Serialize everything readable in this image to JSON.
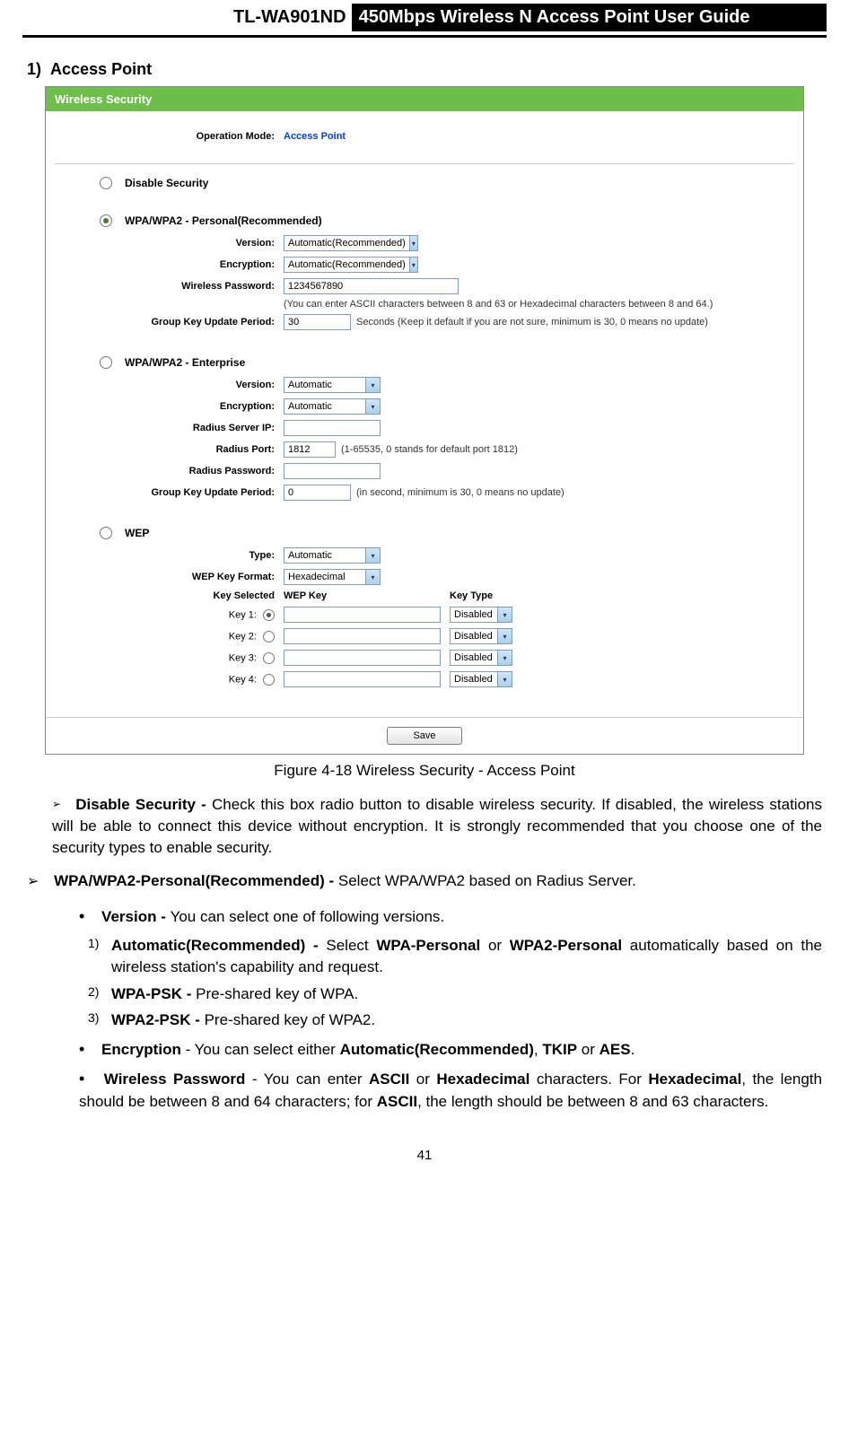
{
  "header": {
    "model": "TL-WA901ND",
    "title": "450Mbps Wireless N Access Point User Guide"
  },
  "section": {
    "number": "1)",
    "title": "Access Point"
  },
  "screenshot": {
    "bannerTitle": "Wireless Security",
    "opModeLabel": "Operation Mode:",
    "opModeValue": "Access Point",
    "disableSecurity": "Disable Security",
    "wpaPersonal": {
      "title": "WPA/WPA2 - Personal(Recommended)",
      "versionLabel": "Version:",
      "versionValue": "Automatic(Recommended)",
      "encryptionLabel": "Encryption:",
      "encryptionValue": "Automatic(Recommended)",
      "passwordLabel": "Wireless Password:",
      "passwordValue": "1234567890",
      "passwordHint": "(You can enter ASCII characters between 8 and 63 or Hexadecimal characters between 8 and 64.)",
      "groupKeyLabel": "Group Key Update Period:",
      "groupKeyValue": "30",
      "groupKeyHint": "Seconds (Keep it default if you are not sure, minimum is 30, 0 means no update)"
    },
    "wpaEnterprise": {
      "title": "WPA/WPA2 - Enterprise",
      "versionLabel": "Version:",
      "versionValue": "Automatic",
      "encryptionLabel": "Encryption:",
      "encryptionValue": "Automatic",
      "radiusIpLabel": "Radius Server IP:",
      "radiusIpValue": "",
      "radiusPortLabel": "Radius Port:",
      "radiusPortValue": "1812",
      "radiusPortHint": "(1-65535, 0 stands for default port 1812)",
      "radiusPwdLabel": "Radius Password:",
      "radiusPwdValue": "",
      "groupKeyLabel": "Group Key Update Period:",
      "groupKeyValue": "0",
      "groupKeyHint": "(in second, minimum is 30, 0 means no update)"
    },
    "wep": {
      "title": "WEP",
      "typeLabel": "Type:",
      "typeValue": "Automatic",
      "formatLabel": "WEP Key Format:",
      "formatValue": "Hexadecimal",
      "keySelectedHeader": "Key Selected",
      "wepKeyHeader": "WEP Key",
      "keyTypeHeader": "Key Type",
      "keys": [
        {
          "label": "Key 1:",
          "selected": true,
          "value": "",
          "type": "Disabled"
        },
        {
          "label": "Key 2:",
          "selected": false,
          "value": "",
          "type": "Disabled"
        },
        {
          "label": "Key 3:",
          "selected": false,
          "value": "",
          "type": "Disabled"
        },
        {
          "label": "Key 4:",
          "selected": false,
          "value": "",
          "type": "Disabled"
        }
      ]
    },
    "saveLabel": "Save"
  },
  "figureCaption": "Figure 4-18 Wireless Security - Access Point",
  "descriptions": {
    "disableSecurity": {
      "bold": "Disable Security - ",
      "text": "Check this box radio button to disable wireless security. If disabled, the wireless stations will be able to connect this device without encryption. It is strongly recommended that you choose one of the security types to enable security."
    },
    "wpaPersonal": {
      "bold": "WPA/WPA2-Personal(Recommended) - ",
      "text": "Select WPA/WPA2 based on Radius Server."
    },
    "version": {
      "bold": "Version - ",
      "text": "You can select one of following versions."
    },
    "auto": {
      "prefix": "1)",
      "bold": "Automatic(Recommended) - ",
      "mid1": "Select ",
      "bold2": "WPA-Personal",
      "mid2": " or ",
      "bold3": "WPA2-Personal",
      "text": " automatically based on the wireless station's capability and request."
    },
    "wpapsk": {
      "prefix": "2)",
      "bold": "WPA-PSK - ",
      "text": "Pre-shared key of WPA."
    },
    "wpa2psk": {
      "prefix": "3)",
      "bold": "WPA2-PSK - ",
      "text": "Pre-shared key of WPA2."
    },
    "encryption": {
      "bold": "Encryption",
      "mid1": " - You can select either ",
      "bold2": "Automatic(Recommended)",
      "mid2": ", ",
      "bold3": "TKIP",
      "mid3": " or ",
      "bold4": "AES",
      "end": "."
    },
    "wirelessPwd": {
      "bold": "Wireless Password",
      "mid1": " - You can enter ",
      "bold2": "ASCII",
      "mid2": " or ",
      "bold3": "Hexadecimal",
      "mid3": " characters. For ",
      "bold4": "Hexadecimal",
      "mid4": ", the length should be between 8 and 64 characters; for ",
      "bold5": "ASCII",
      "end": ", the length should be between 8 and 63 characters."
    }
  },
  "pageNumber": "41"
}
